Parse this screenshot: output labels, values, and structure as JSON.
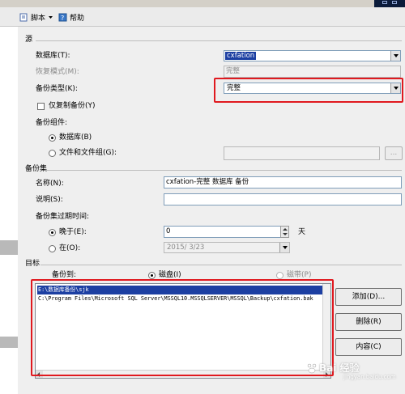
{
  "toolbar": {
    "script_label": "脚本",
    "help_label": "帮助"
  },
  "source": {
    "section_label": "源",
    "database_label": "数据库(T):",
    "database_value": "cxfation",
    "recovery_model_label": "恢复模式(M):",
    "recovery_model_value": "完整",
    "backup_type_label": "备份类型(K):",
    "backup_type_value": "完整",
    "copy_only_label": "仅复制备份(Y)",
    "backup_component_label": "备份组件:",
    "component_database_label": "数据库(B)",
    "component_files_label": "文件和文件组(G):",
    "browse_label": "..."
  },
  "backup_set": {
    "section_label": "备份集",
    "name_label": "名称(N):",
    "name_value": "cxfation-完整 数据库 备份",
    "description_label": "说明(S):",
    "description_value": "",
    "expiry_label": "备份集过期时间:",
    "after_label": "晚于(E):",
    "after_value": "0",
    "days_label": "天",
    "on_label": "在(O):",
    "on_value": "2015/ 3/23"
  },
  "destination": {
    "section_label": "目标",
    "backup_to_label": "备份到:",
    "disk_label": "磁盘(I)",
    "tape_label": "磁带(P)",
    "list_items": [
      "E:\\数据库备份\\sjk",
      "C:\\Program Files\\Microsoft SQL Server\\MSSQL10.MSSQLSERVER\\MSSQL\\Backup\\cxfation.bak"
    ],
    "add_button": "添加(D)...",
    "remove_button": "删除(R)",
    "contents_button": "内容(C)"
  },
  "watermark": {
    "text": "Bai 经验",
    "sub": "jingyan.baidu.com"
  },
  "colors": {
    "highlight": "#e0191f",
    "selection": "#1c3fa2"
  }
}
